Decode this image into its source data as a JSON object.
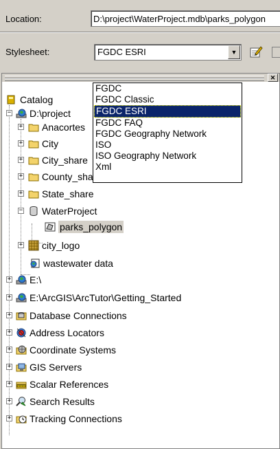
{
  "location": {
    "label": "Location:",
    "value": "D:\\project\\WaterProject.mdb\\parks_polygon"
  },
  "stylesheet": {
    "label": "Stylesheet:",
    "selected": "FGDC ESRI",
    "options": [
      "FGDC",
      "FGDC Classic",
      "FGDC ESRI",
      "FGDC FAQ",
      "FGDC Geography Network",
      "ISO",
      "ISO Geography Network",
      "Xml"
    ],
    "highlighted_index": 2
  },
  "tree": {
    "root": "Catalog",
    "d_drive": "D:\\project",
    "d_children": [
      "Anacortes",
      "City",
      "City_share",
      "County_share",
      "State_share"
    ],
    "water_project": "WaterProject",
    "parks": "parks_polygon",
    "city_logo": "city_logo",
    "wastewater": "wastewater data",
    "e_drive": "E:\\",
    "e_tutor": "E:\\ArcGIS\\ArcTutor\\Getting_Started",
    "tools": [
      "Database Connections",
      "Address Locators",
      "Coordinate Systems",
      "GIS Servers",
      "Scalar References",
      "Search Results",
      "Tracking Connections"
    ]
  },
  "colors": {
    "selection": "#0a246a",
    "panel_bg": "#d4d0c8",
    "folder": "#f3d36b"
  }
}
